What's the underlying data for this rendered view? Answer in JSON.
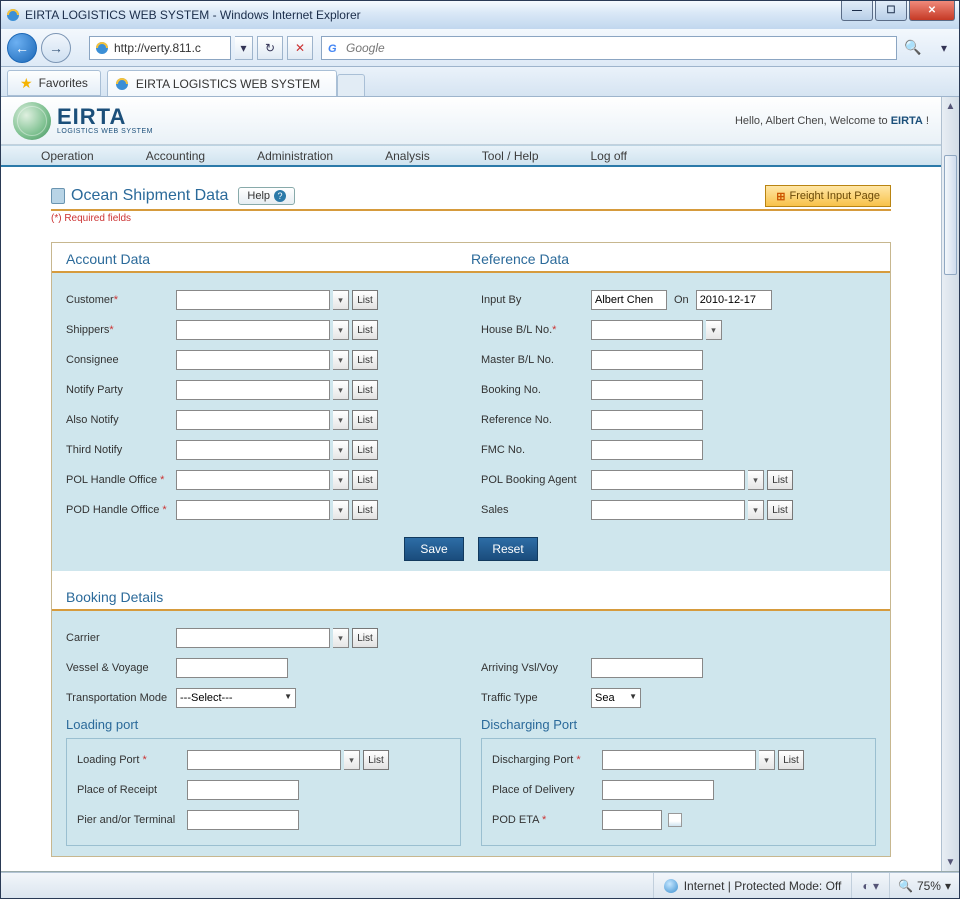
{
  "window": {
    "title": "EIRTA LOGISTICS WEB SYSTEM - Windows Internet Explorer"
  },
  "browser": {
    "url": "http://verty.811.c",
    "search_placeholder": "Google",
    "favorites_label": "Favorites",
    "tab_title": "EIRTA LOGISTICS WEB SYSTEM"
  },
  "banner": {
    "brand": "EIRTA",
    "brand_sub": "LOGISTICS WEB SYSTEM",
    "greeting_prefix": "Hello, ",
    "user": "Albert Chen",
    "greeting_mid": ", Welcome to ",
    "greeting_brand": "EIRTA",
    "greeting_suffix": " !"
  },
  "menu": {
    "items": [
      "Operation",
      "Accounting",
      "Administration",
      "Analysis",
      "Tool / Help",
      "Log off"
    ]
  },
  "page": {
    "title": "Ocean Shipment Data",
    "help_label": "Help",
    "freight_btn": "Freight Input Page",
    "required_note": "(*) Required fields"
  },
  "section_account": {
    "title_left": "Account Data",
    "title_right": "Reference Data",
    "left": {
      "customer": "Customer",
      "shippers": "Shippers",
      "consignee": "Consignee",
      "notify": "Notify Party",
      "also_notify": "Also Notify",
      "third_notify": "Third Notify",
      "pol_office": "POL Handle Office",
      "pod_office": "POD Handle Office"
    },
    "right": {
      "input_by": "Input By",
      "input_by_value": "Albert Chen",
      "on_label": "On",
      "on_value": "2010-12-17",
      "house_bl": "House B/L No.",
      "master_bl": "Master B/L No.",
      "booking_no": "Booking No.",
      "reference_no": "Reference No.",
      "fmc_no": "FMC No.",
      "pol_agent": "POL Booking Agent",
      "sales": "Sales"
    },
    "save": "Save",
    "reset": "Reset",
    "list_btn": "List"
  },
  "section_booking": {
    "title": "Booking Details",
    "carrier": "Carrier",
    "vessel_voyage": "Vessel & Voyage",
    "arriving_vsl": "Arriving Vsl/Voy",
    "trans_mode": "Transportation Mode",
    "trans_mode_value": "---Select---",
    "traffic_type": "Traffic Type",
    "traffic_type_value": "Sea",
    "loading_head": "Loading port",
    "discharging_head": "Discharging Port",
    "loading_port": "Loading Port",
    "place_receipt": "Place of Receipt",
    "pier_terminal": "Pier and/or Terminal",
    "discharging_port": "Discharging Port",
    "place_delivery": "Place of Delivery",
    "pod_eta": "POD ETA",
    "list_btn": "List"
  },
  "statusbar": {
    "zone": "Internet | Protected Mode: Off",
    "zoom": "75%"
  }
}
